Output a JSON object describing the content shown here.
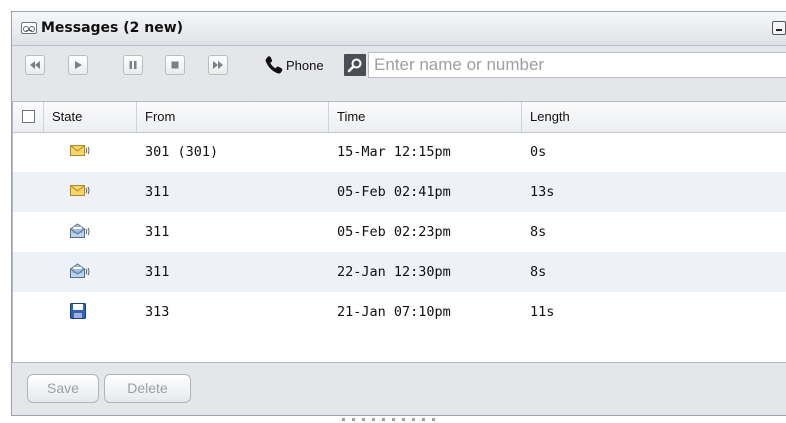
{
  "window": {
    "title": "Messages (2 new)",
    "title_icon": "voicemail-icon",
    "minimize_icon": "minimize-icon"
  },
  "toolbar": {
    "buttons": [
      "rewind-icon",
      "play-icon",
      "pause-icon",
      "stop-icon",
      "fast-forward-icon"
    ],
    "phone_label": "Phone",
    "phone_icon": "phone-icon",
    "search_icon": "search-icon",
    "search_placeholder": "Enter name or number",
    "search_value": ""
  },
  "table": {
    "columns": [
      "State",
      "From",
      "Time",
      "Length"
    ],
    "rows": [
      {
        "state": "new-message-icon",
        "from": "301 (301)",
        "time": "15-Mar 12:15pm",
        "length": "0s"
      },
      {
        "state": "new-message-icon",
        "from": "311",
        "time": "05-Feb 02:41pm",
        "length": "13s"
      },
      {
        "state": "read-message-icon",
        "from": "311",
        "time": "05-Feb 02:23pm",
        "length": "8s"
      },
      {
        "state": "read-message-icon",
        "from": "311",
        "time": "22-Jan 12:30pm",
        "length": "8s"
      },
      {
        "state": "saved-message-icon",
        "from": "313",
        "time": "21-Jan 07:10pm",
        "length": "11s"
      }
    ]
  },
  "footer": {
    "save_label": "Save",
    "delete_label": "Delete"
  },
  "colors": {
    "alt_row": "#eef1f8",
    "panel_bg": "#e4e6ea",
    "disabled_text": "#9aa0a6"
  }
}
